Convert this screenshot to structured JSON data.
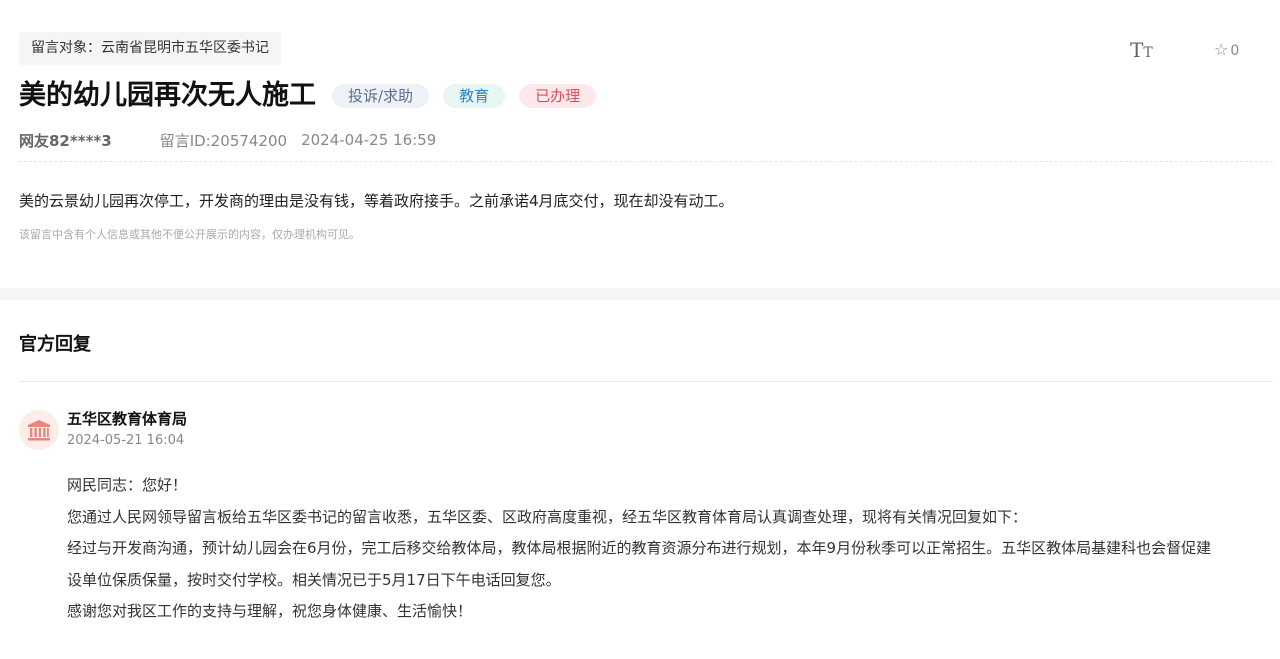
{
  "message": {
    "target": "留言对象：云南省昆明市五华区委书记",
    "title": "美的幼儿园再次无人施工",
    "tags": {
      "type": "投诉/求助",
      "category": "教育",
      "status": "已办理"
    },
    "author": "网友82****3",
    "message_id": "留言ID:20574200",
    "datetime": "2024-04-25 16:59",
    "content": "美的云景幼儿园再次停工，开发商的理由是没有钱，等着政府接手。之前承诺4月底交付，现在却没有动工。",
    "privacy_note": "该留言中含有个人信息或其他不便公开展示的内容，仅办理机构可见。"
  },
  "toolbar": {
    "font_size_big": "T",
    "font_size_small": "T",
    "favorite_count": "0"
  },
  "reply": {
    "heading": "官方回复",
    "department": "五华区教育体育局",
    "datetime": "2024-05-21 16:04",
    "paragraphs": [
      "网民同志：您好！",
      "您通过人民网领导留言板给五华区委书记的留言收悉，五华区委、区政府高度重视，经五华区教育体育局认真调查处理，现将有关情况回复如下：",
      "经过与开发商沟通，预计幼儿园会在6月份，完工后移交给教体局，教体局根据附近的教育资源分布进行规划，本年9月份秋季可以正常招生。五华区教体局基建科也会督促建",
      "设单位保质保量，按时交付学校。相关情况已于5月17日下午电话回复您。",
      "感谢您对我区工作的支持与理解，祝您身体健康、生活愉快！"
    ]
  },
  "colors": {
    "badge_type_text": "#5a6f8f",
    "badge_category_text": "#2a86c8",
    "badge_status_text": "#e24a5a",
    "department_icon": "#e8867a"
  },
  "icons": {
    "font_size": "font-size-icon",
    "favorite": "star-outline-icon",
    "department": "government-building-icon"
  }
}
